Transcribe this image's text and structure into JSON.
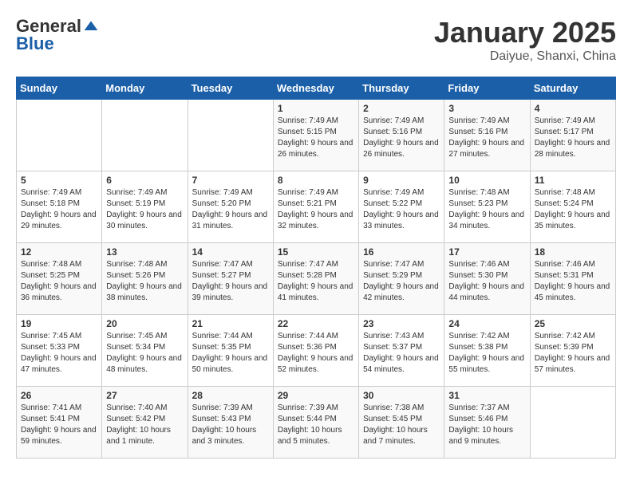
{
  "logo": {
    "general": "General",
    "blue": "Blue"
  },
  "title": "January 2025",
  "subtitle": "Daiyue, Shanxi, China",
  "days_header": [
    "Sunday",
    "Monday",
    "Tuesday",
    "Wednesday",
    "Thursday",
    "Friday",
    "Saturday"
  ],
  "weeks": [
    [
      {
        "day": "",
        "info": ""
      },
      {
        "day": "",
        "info": ""
      },
      {
        "day": "",
        "info": ""
      },
      {
        "day": "1",
        "info": "Sunrise: 7:49 AM\nSunset: 5:15 PM\nDaylight: 9 hours and 26 minutes."
      },
      {
        "day": "2",
        "info": "Sunrise: 7:49 AM\nSunset: 5:16 PM\nDaylight: 9 hours and 26 minutes."
      },
      {
        "day": "3",
        "info": "Sunrise: 7:49 AM\nSunset: 5:16 PM\nDaylight: 9 hours and 27 minutes."
      },
      {
        "day": "4",
        "info": "Sunrise: 7:49 AM\nSunset: 5:17 PM\nDaylight: 9 hours and 28 minutes."
      }
    ],
    [
      {
        "day": "5",
        "info": "Sunrise: 7:49 AM\nSunset: 5:18 PM\nDaylight: 9 hours and 29 minutes."
      },
      {
        "day": "6",
        "info": "Sunrise: 7:49 AM\nSunset: 5:19 PM\nDaylight: 9 hours and 30 minutes."
      },
      {
        "day": "7",
        "info": "Sunrise: 7:49 AM\nSunset: 5:20 PM\nDaylight: 9 hours and 31 minutes."
      },
      {
        "day": "8",
        "info": "Sunrise: 7:49 AM\nSunset: 5:21 PM\nDaylight: 9 hours and 32 minutes."
      },
      {
        "day": "9",
        "info": "Sunrise: 7:49 AM\nSunset: 5:22 PM\nDaylight: 9 hours and 33 minutes."
      },
      {
        "day": "10",
        "info": "Sunrise: 7:48 AM\nSunset: 5:23 PM\nDaylight: 9 hours and 34 minutes."
      },
      {
        "day": "11",
        "info": "Sunrise: 7:48 AM\nSunset: 5:24 PM\nDaylight: 9 hours and 35 minutes."
      }
    ],
    [
      {
        "day": "12",
        "info": "Sunrise: 7:48 AM\nSunset: 5:25 PM\nDaylight: 9 hours and 36 minutes."
      },
      {
        "day": "13",
        "info": "Sunrise: 7:48 AM\nSunset: 5:26 PM\nDaylight: 9 hours and 38 minutes."
      },
      {
        "day": "14",
        "info": "Sunrise: 7:47 AM\nSunset: 5:27 PM\nDaylight: 9 hours and 39 minutes."
      },
      {
        "day": "15",
        "info": "Sunrise: 7:47 AM\nSunset: 5:28 PM\nDaylight: 9 hours and 41 minutes."
      },
      {
        "day": "16",
        "info": "Sunrise: 7:47 AM\nSunset: 5:29 PM\nDaylight: 9 hours and 42 minutes."
      },
      {
        "day": "17",
        "info": "Sunrise: 7:46 AM\nSunset: 5:30 PM\nDaylight: 9 hours and 44 minutes."
      },
      {
        "day": "18",
        "info": "Sunrise: 7:46 AM\nSunset: 5:31 PM\nDaylight: 9 hours and 45 minutes."
      }
    ],
    [
      {
        "day": "19",
        "info": "Sunrise: 7:45 AM\nSunset: 5:33 PM\nDaylight: 9 hours and 47 minutes."
      },
      {
        "day": "20",
        "info": "Sunrise: 7:45 AM\nSunset: 5:34 PM\nDaylight: 9 hours and 48 minutes."
      },
      {
        "day": "21",
        "info": "Sunrise: 7:44 AM\nSunset: 5:35 PM\nDaylight: 9 hours and 50 minutes."
      },
      {
        "day": "22",
        "info": "Sunrise: 7:44 AM\nSunset: 5:36 PM\nDaylight: 9 hours and 52 minutes."
      },
      {
        "day": "23",
        "info": "Sunrise: 7:43 AM\nSunset: 5:37 PM\nDaylight: 9 hours and 54 minutes."
      },
      {
        "day": "24",
        "info": "Sunrise: 7:42 AM\nSunset: 5:38 PM\nDaylight: 9 hours and 55 minutes."
      },
      {
        "day": "25",
        "info": "Sunrise: 7:42 AM\nSunset: 5:39 PM\nDaylight: 9 hours and 57 minutes."
      }
    ],
    [
      {
        "day": "26",
        "info": "Sunrise: 7:41 AM\nSunset: 5:41 PM\nDaylight: 9 hours and 59 minutes."
      },
      {
        "day": "27",
        "info": "Sunrise: 7:40 AM\nSunset: 5:42 PM\nDaylight: 10 hours and 1 minute."
      },
      {
        "day": "28",
        "info": "Sunrise: 7:39 AM\nSunset: 5:43 PM\nDaylight: 10 hours and 3 minutes."
      },
      {
        "day": "29",
        "info": "Sunrise: 7:39 AM\nSunset: 5:44 PM\nDaylight: 10 hours and 5 minutes."
      },
      {
        "day": "30",
        "info": "Sunrise: 7:38 AM\nSunset: 5:45 PM\nDaylight: 10 hours and 7 minutes."
      },
      {
        "day": "31",
        "info": "Sunrise: 7:37 AM\nSunset: 5:46 PM\nDaylight: 10 hours and 9 minutes."
      },
      {
        "day": "",
        "info": ""
      }
    ]
  ]
}
